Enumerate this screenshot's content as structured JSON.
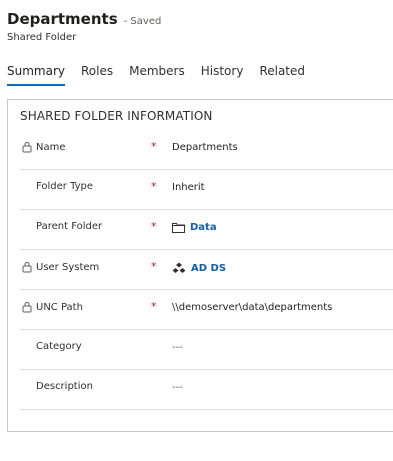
{
  "header": {
    "title": "Departments",
    "status": "- Saved",
    "subtitle": "Shared Folder"
  },
  "tabs": [
    {
      "label": "Summary",
      "active": true
    },
    {
      "label": "Roles"
    },
    {
      "label": "Members"
    },
    {
      "label": "History"
    },
    {
      "label": "Related"
    }
  ],
  "section": {
    "title": "SHARED FOLDER INFORMATION"
  },
  "fields": [
    {
      "label": "Name",
      "value": "Departments"
    },
    {
      "label": "Folder Type",
      "value": "Inherit"
    },
    {
      "label": "Parent Folder",
      "value": "Data"
    },
    {
      "label": "User System",
      "value": "AD DS"
    },
    {
      "label": "UNC Path",
      "value": "\\\\demoserver\\data\\departments"
    },
    {
      "label": "Category",
      "value": "---"
    },
    {
      "label": "Description",
      "value": "---"
    }
  ],
  "required_marker": "*",
  "colors": {
    "accent": "#0f6cbd",
    "link": "#115ea3",
    "required": "#a4262c"
  }
}
